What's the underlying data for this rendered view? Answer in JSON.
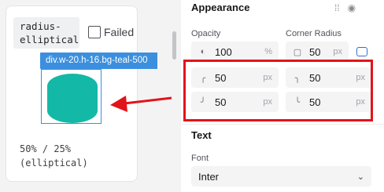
{
  "preview": {
    "class_label": "radius-\nelliptical",
    "failed_label": "Failed",
    "failed_checked": false,
    "element_tag": "div.w-20.h-16.bg-teal-500",
    "caption": "50% / 25%\n(elliptical)",
    "fill_color": "#14b8a6"
  },
  "appearance": {
    "title": "Appearance",
    "opacity_label": "Opacity",
    "opacity_value": "100",
    "opacity_unit": "%",
    "corner_radius_label": "Corner Radius",
    "corner_radius_value": "50",
    "corner_radius_unit": "px",
    "corners": [
      {
        "icon": "corner-top-left-icon",
        "value": "50",
        "unit": "px"
      },
      {
        "icon": "corner-top-right-icon",
        "value": "50",
        "unit": "px"
      },
      {
        "icon": "corner-bottom-left-icon",
        "value": "50",
        "unit": "px"
      },
      {
        "icon": "corner-bottom-right-icon",
        "value": "50",
        "unit": "px"
      }
    ]
  },
  "text": {
    "title": "Text",
    "font_label": "Font",
    "font_value": "Inter"
  },
  "colors": {
    "highlight": "#e1141a",
    "selection": "#3b8fde"
  }
}
